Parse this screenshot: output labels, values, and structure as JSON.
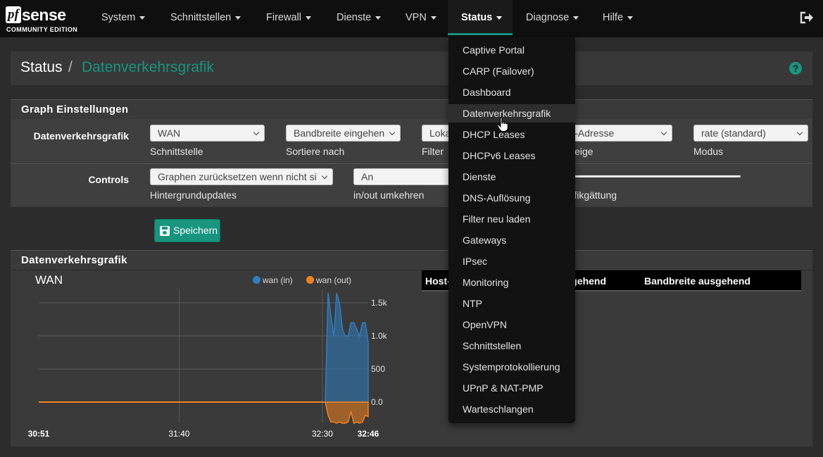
{
  "logo": {
    "pf": "pf",
    "sense": "sense",
    "subtitle": "COMMUNITY EDITION"
  },
  "nav": {
    "items": [
      {
        "label": "System"
      },
      {
        "label": "Schnittstellen"
      },
      {
        "label": "Firewall"
      },
      {
        "label": "Dienste"
      },
      {
        "label": "VPN"
      },
      {
        "label": "Status"
      },
      {
        "label": "Diagnose"
      },
      {
        "label": "Hilfe"
      }
    ],
    "active": "Status"
  },
  "breadcrumb": {
    "section": "Status",
    "separator": "/",
    "page": "Datenverkehrsgrafik",
    "help": "?"
  },
  "settings": {
    "title": "Graph Einstellungen",
    "row1_label": "Datenverkehrsgrafik",
    "interface": {
      "value": "WAN",
      "caption": "Schnittstelle"
    },
    "sort": {
      "value": "Bandbreite eingehend",
      "caption": "Sortiere nach"
    },
    "filter": {
      "value": "Lokal",
      "caption": "Filter"
    },
    "display": {
      "value": "IP-Adresse",
      "caption": "Anzeige"
    },
    "mode": {
      "value": "rate (standard)",
      "caption": "Modus"
    },
    "row2_label": "Controls",
    "background": {
      "value": "Graphen zurücksetzen wenn nicht sichtbar",
      "caption": "Hintergrundupdates"
    },
    "invert": {
      "value": "An",
      "caption": "in/out umkehren"
    },
    "smoothing": {
      "caption": "Grafikgättung",
      "value": 0
    }
  },
  "save_button": "Speichern",
  "graph": {
    "panel_title": "Datenverkehrsgrafik",
    "table": {
      "col1": "Host-IP",
      "col2": "Bandbreite eingehend",
      "col3": "Bandbreite ausgehend"
    }
  },
  "chart_data": {
    "type": "area",
    "title": "WAN",
    "x_ticks": [
      "30:51",
      "31:40",
      "32:30",
      "32:46"
    ],
    "y_ticks": [
      "1.5k",
      "1.0k",
      "500",
      "0.0"
    ],
    "ylim": [
      -300,
      1500
    ],
    "legend_position": "top",
    "grid": true,
    "series": [
      {
        "name": "wan (in)",
        "color": "#2f7ec2",
        "x": [
          "32:31",
          "32:32",
          "32:33",
          "32:34",
          "32:35",
          "32:36",
          "32:37",
          "32:38",
          "32:39",
          "32:40",
          "32:41",
          "32:42",
          "32:43",
          "32:44",
          "32:45",
          "32:46"
        ],
        "values": [
          0,
          1650,
          1300,
          1000,
          1650,
          1500,
          1100,
          1000,
          1000,
          1200,
          1200,
          1100,
          1000,
          1200,
          1200,
          900
        ]
      },
      {
        "name": "wan (out)",
        "color": "#f0821e",
        "x": [
          "32:31",
          "32:32",
          "32:33",
          "32:34",
          "32:35",
          "32:36",
          "32:37",
          "32:38",
          "32:39",
          "32:40",
          "32:41",
          "32:42",
          "32:43",
          "32:44",
          "32:45",
          "32:46"
        ],
        "values": [
          0,
          -200,
          -300,
          -300,
          -320,
          -300,
          -320,
          -320,
          -300,
          -150,
          -320,
          -300,
          -320,
          -300,
          -200,
          -220
        ]
      }
    ]
  },
  "status_menu": {
    "items": [
      "Captive Portal",
      "CARP (Failover)",
      "Dashboard",
      "Datenverkehrsgrafik",
      "DHCP Leases",
      "DHCPv6 Leases",
      "Dienste",
      "DNS-Auflösung",
      "Filter neu laden",
      "Gateways",
      "IPsec",
      "Monitoring",
      "NTP",
      "OpenVPN",
      "Schnittstellen",
      "Systemprotokollierung",
      "UPnP & NAT-PMP",
      "Warteschlangen"
    ],
    "hovered": "Datenverkehrsgrafik"
  },
  "colors": {
    "accent": "#18957f",
    "navbar": "#0f0f0f",
    "in": "#2f7ec2",
    "out": "#f0821e"
  }
}
